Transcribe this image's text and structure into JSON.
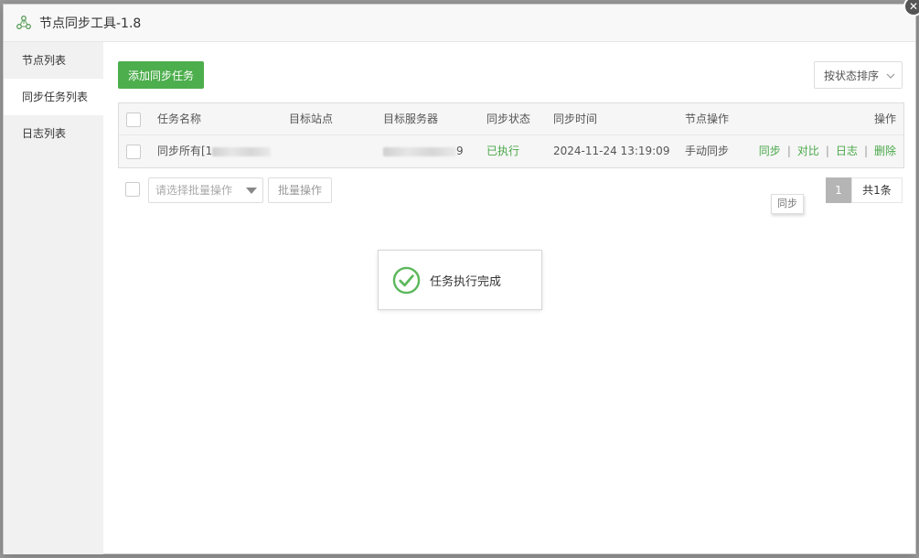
{
  "window": {
    "title": "节点同步工具-1.8",
    "logo_icon": "node-sync-logo-icon",
    "close_icon": "close-icon",
    "close_glyph": "✕"
  },
  "sidebar": {
    "items": [
      {
        "label": "节点列表",
        "active": false
      },
      {
        "label": "同步任务列表",
        "active": true
      },
      {
        "label": "日志列表",
        "active": false
      }
    ]
  },
  "toolbar": {
    "add_task_label": "添加同步任务",
    "sort_label": "按状态排序"
  },
  "table": {
    "headers": [
      "任务名称",
      "目标站点",
      "目标服务器",
      "同步状态",
      "同步时间",
      "节点操作",
      "操作"
    ],
    "rows": [
      {
        "task_name": "同步所有[1",
        "target_site": "",
        "target_server_suffix": "9",
        "status": "已执行",
        "sync_time": "2024-11-24 13:19:09",
        "node_op": "手动同步",
        "actions": [
          "同步",
          "对比",
          "日志",
          "删除"
        ]
      }
    ]
  },
  "batch": {
    "placeholder": "请选择批量操作",
    "button_label": "批量操作"
  },
  "pager": {
    "current_page": "1",
    "total_label": "共1条"
  },
  "tooltip": {
    "text": "同步"
  },
  "toast": {
    "message": "任务执行完成",
    "icon": "check-circle-icon"
  },
  "colors": {
    "accent_green": "#4cae4c",
    "link_green": "#4aa84a",
    "sidebar_bg": "#f1f1f1",
    "pager_active": "#b5b5b5"
  }
}
